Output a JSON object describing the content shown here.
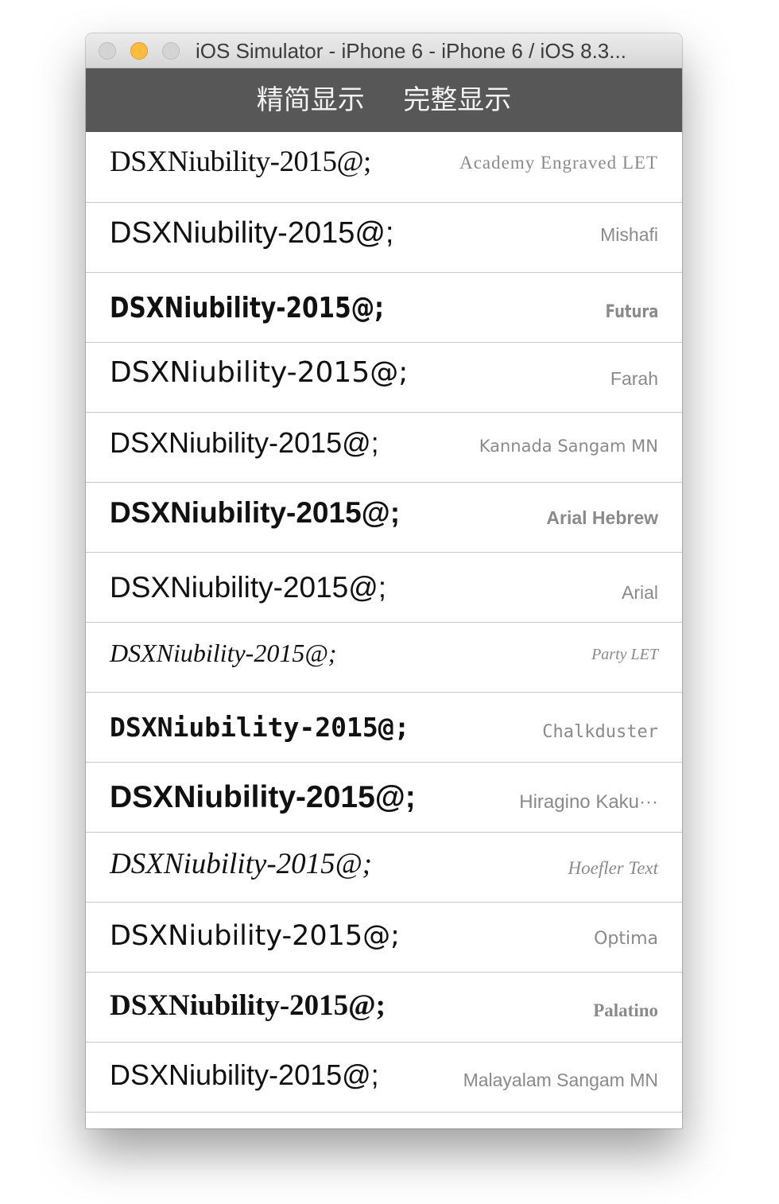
{
  "window": {
    "title": "iOS Simulator - iPhone 6 - iPhone 6 / iOS 8.3..."
  },
  "navbar": {
    "segments": [
      "精简显示",
      "完整显示"
    ]
  },
  "rows": [
    {
      "sample": "DSXNiubility-2015@;",
      "font": "Academy Engraved LET"
    },
    {
      "sample": "DSXNiubility-2015@;",
      "font": "Mishafi"
    },
    {
      "sample": "DSXNiubility-2015@;",
      "font": "Futura"
    },
    {
      "sample": "DSXNiubility-2015@;",
      "font": "Farah"
    },
    {
      "sample": "DSXNiubility-2015@;",
      "font": "Kannada Sangam MN"
    },
    {
      "sample": "DSXNiubility-2015@;",
      "font": "Arial Hebrew"
    },
    {
      "sample": "DSXNiubility-2015@;",
      "font": "Arial"
    },
    {
      "sample": "DSXNiubility-2015@;",
      "font": "Party LET"
    },
    {
      "sample": "DSXNiubility-2015@;",
      "font": "Chalkduster"
    },
    {
      "sample": "DSXNiubility-2015@;",
      "font": "Hiragino Kaku···"
    },
    {
      "sample": "DSXNiubility-2015@;",
      "font": "Hoefler Text"
    },
    {
      "sample": "DSXNiubility-2015@;",
      "font": "Optima"
    },
    {
      "sample": "DSXNiubility-2015@;",
      "font": "Palatino"
    },
    {
      "sample": "DSXNiubility-2015@;",
      "font": "Malayalam Sangam MN"
    }
  ],
  "colors": {
    "navbar": "#575757",
    "separator": "#c8c7cc",
    "minimize_button": "#fdbc40"
  }
}
